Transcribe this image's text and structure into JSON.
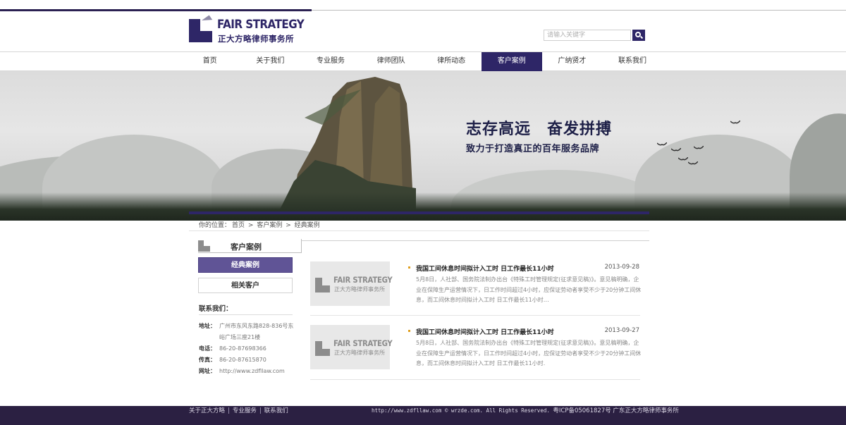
{
  "brand": {
    "name_en": "FAIR STRATEGY",
    "name_cn": "正大方略律师事务所"
  },
  "search": {
    "placeholder": "请输入关键字",
    "button_icon": "search-icon"
  },
  "nav": {
    "items": [
      {
        "label": "首页"
      },
      {
        "label": "关于我们"
      },
      {
        "label": "专业服务"
      },
      {
        "label": "律师团队"
      },
      {
        "label": "律所动态"
      },
      {
        "label": "客户案例"
      },
      {
        "label": "广纳贤才"
      },
      {
        "label": "联系我们"
      }
    ],
    "active_index": 5
  },
  "banner": {
    "slogan_main": "志存高远　奋发拼搏",
    "slogan_sub": "致力于打造真正的百年服务品牌"
  },
  "breadcrumb": {
    "prefix": "你的位置：",
    "items": [
      "首页",
      "客户案例",
      "经典案例"
    ],
    "separator": ">"
  },
  "sidebar": {
    "title": "客户案例",
    "buttons": [
      {
        "label": "经典案例"
      },
      {
        "label": "相关客户"
      }
    ],
    "contact_title": "联系我们：",
    "contact": {
      "address_label": "地址：",
      "address": "广州市东风东路828-836号东峪广场三座21楼",
      "phone_label": "电话：",
      "phone": "86-20-87698366",
      "fax_label": "传真：",
      "fax": "86-20-87615870",
      "site_label": "网址：",
      "site": "http://www.zdfllaw.com"
    }
  },
  "articles": [
    {
      "title": "我国工间休息时间拟计入工时 日工作最长11小时",
      "date": "2013-09-28",
      "summary": "5月8日，人社部、国务院法制办出台《特殊工时管理规定(征求意见稿)》。意见稿明确，企业在保障生产运营情况下，日工作时间超过4小时，应保证劳动者享受不少于20分钟工间休息，而工间休息时间拟计入工时 日工作最长11小时…",
      "thumb_en": "FAIR STRATEGY",
      "thumb_cn": "正大方略律师事务所"
    },
    {
      "title": "我国工间休息时间拟计入工时 日工作最长11小时",
      "date": "2013-09-27",
      "summary": "5月8日，人社部、国务院法制办出台《特殊工时管理规定(征求意见稿)》。意见稿明确，企业在保障生产运营情况下，日工作时间超过4小时，应保证劳动者享受不少于20分钟工间休息，而工间休息时间拟计入工时 日工作最长11小时.",
      "thumb_en": "FAIR STRATEGY",
      "thumb_cn": "正大方略律师事务所"
    }
  ],
  "footer": {
    "links": [
      "关于正大方略",
      "专业服务",
      "联系我们"
    ],
    "link_separator": "|",
    "copyright": "http://www.zdfllaw.com © wrzde.com. All Rights Reserved.",
    "icp": "粤ICP备05061827号 广东正大方略律师事务所"
  },
  "colors": {
    "brand": "#2e2667",
    "sidebar_active": "#605496",
    "footer_bg": "#2b2042",
    "bullet": "#e0a020"
  }
}
